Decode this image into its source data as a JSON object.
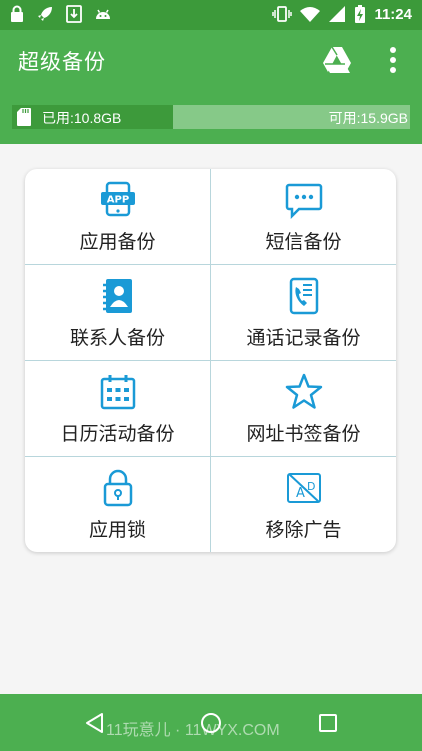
{
  "status_bar": {
    "time": "11:24",
    "left_icons": [
      "lock-icon",
      "rocket-icon",
      "download-icon",
      "android-icon"
    ],
    "right_icons": [
      "vibrate-icon",
      "wifi-icon",
      "signal-icon",
      "battery-charging-icon"
    ]
  },
  "app_bar": {
    "title": "超级备份",
    "actions": [
      "google-drive-icon",
      "more-vert-icon"
    ]
  },
  "storage": {
    "used_label": "已用:10.8GB",
    "free_label": "可用:15.9GB",
    "used_fraction": 0.405
  },
  "features": [
    {
      "label": "应用备份",
      "icon": "app-icon"
    },
    {
      "label": "短信备份",
      "icon": "sms-icon"
    },
    {
      "label": "联系人备份",
      "icon": "contacts-icon"
    },
    {
      "label": "通话记录备份",
      "icon": "call-log-icon"
    },
    {
      "label": "日历活动备份",
      "icon": "calendar-icon"
    },
    {
      "label": "网址书签备份",
      "icon": "star-icon"
    },
    {
      "label": "应用锁",
      "icon": "lock-icon"
    },
    {
      "label": "移除广告",
      "icon": "remove-ads-icon"
    }
  ],
  "nav_bar": {
    "watermark": "11玩意儿 · 11WYX.COM",
    "buttons": [
      "back-icon",
      "home-icon",
      "recent-apps-icon"
    ]
  },
  "colors": {
    "primary": "#4caf50",
    "primary_dark": "#3c9a3a",
    "icon_blue": "#1a9ad6",
    "storage_free": "#86c988"
  }
}
